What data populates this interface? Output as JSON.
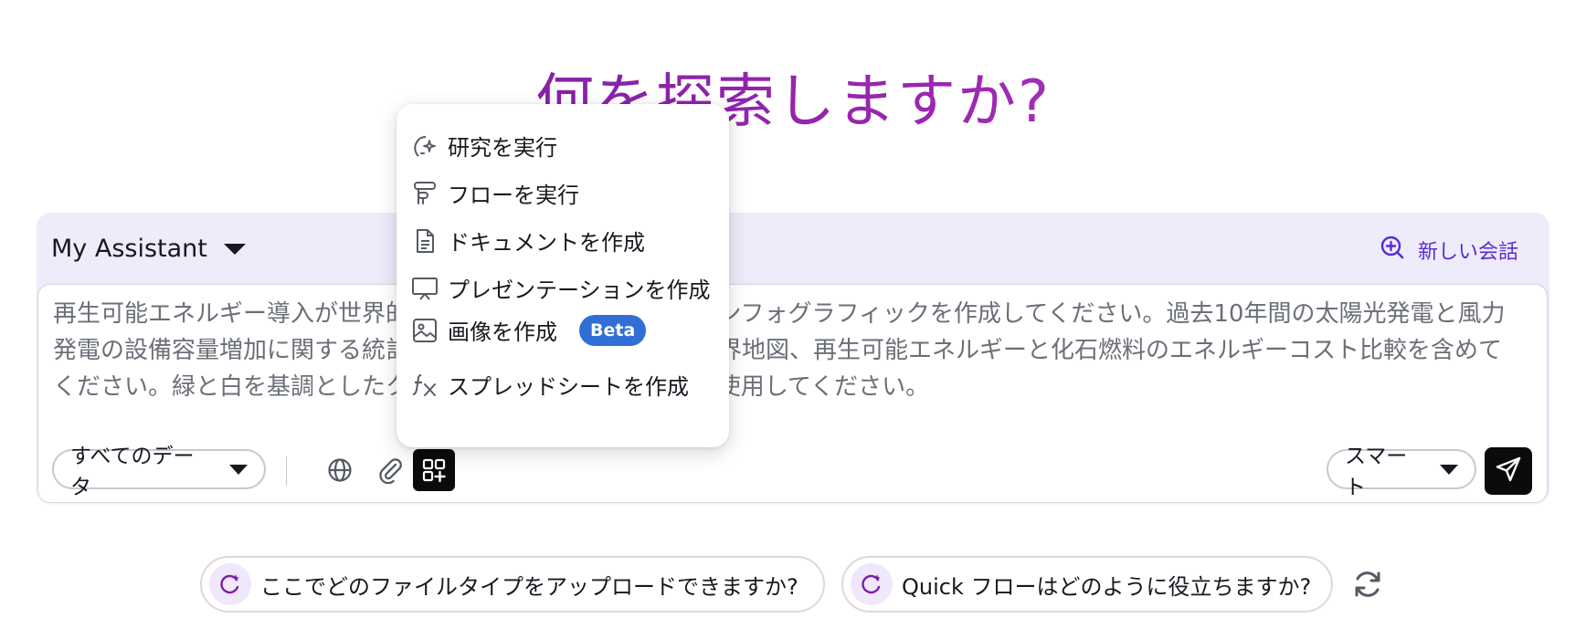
{
  "hero": {
    "title": "何を探索しますか?"
  },
  "assistant": {
    "name": "My Assistant",
    "new_chat_label": "新しい会話"
  },
  "prompt": {
    "text": "再生可能エネルギー導入が世界的に加速している様子を示すインフォグラフィックを作成してください。過去10年間の太陽光発電と風力発電の設備容量増加に関する統計、主要国の導入状況を示す世界地図、再生可能エネルギーと化石燃料のエネルギーコスト比較を含めてください。緑と白を基調としたクリーンでモダンなデザインを使用してください。"
  },
  "toolbar": {
    "data_source_label": "すべてのデータ",
    "mode_label": "スマート",
    "icons": [
      "globe-icon",
      "paperclip-icon",
      "apps-add-icon",
      "send-icon"
    ]
  },
  "menu": {
    "items": [
      {
        "label": "研究を実行",
        "icon": "research-sparkle-icon"
      },
      {
        "label": "フローを実行",
        "icon": "flow-icon"
      },
      {
        "label": "ドキュメントを作成",
        "icon": "document-icon"
      },
      {
        "label": "プレゼンテーションを作成",
        "icon": "presentation-icon"
      },
      {
        "label": "画像を作成",
        "icon": "image-icon",
        "badge": "Beta"
      },
      {
        "label": "スプレッドシートを作成",
        "icon": "fx-icon"
      }
    ]
  },
  "suggestions": [
    {
      "text": "ここでどのファイルタイプをアップロードできますか?"
    },
    {
      "text": "Quick フローはどのように役立ちますか?"
    }
  ],
  "colors": {
    "title_gradient_start": "#6a1b9a",
    "title_gradient_end": "#b35bd0",
    "panel_bg": "#eeebfb",
    "accent": "#5a2bd1",
    "beta_badge": "#2f6fd6",
    "dark_button": "#0b0b0b"
  }
}
